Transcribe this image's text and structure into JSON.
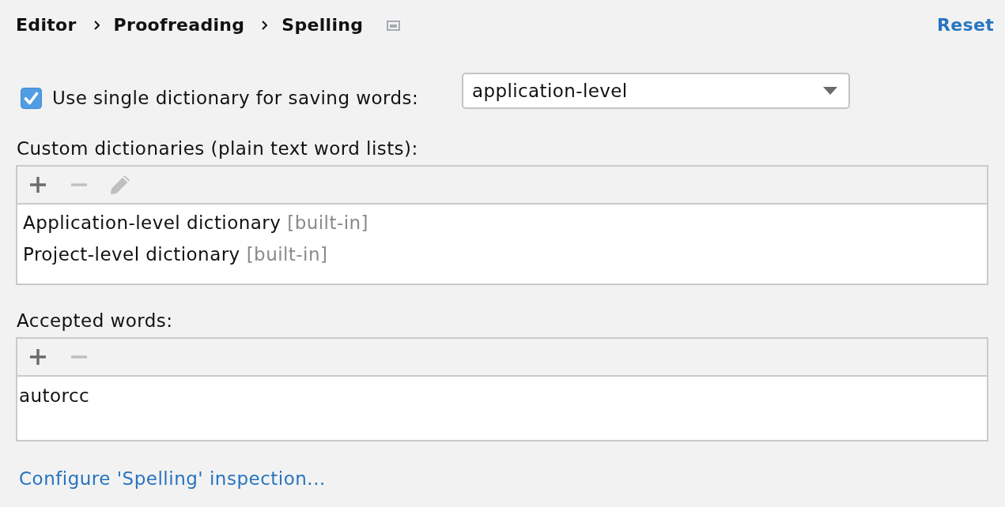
{
  "breadcrumb": [
    {
      "label": "Editor"
    },
    {
      "label": "Proofreading"
    },
    {
      "label": "Spelling"
    }
  ],
  "reset_link": "Reset",
  "use_single_dictionary": {
    "label": "Use single dictionary for saving words:",
    "checked": true
  },
  "dictionary_level": {
    "value": "application-level"
  },
  "custom_dictionaries": {
    "label": "Custom dictionaries (plain text word lists):",
    "toolbar": [
      {
        "kind": "add",
        "disabled": false
      },
      {
        "kind": "remove",
        "disabled": true
      },
      {
        "kind": "edit",
        "disabled": true
      }
    ],
    "items": [
      {
        "name": "Application-level dictionary",
        "note": "[built-in]",
        "selected": false
      },
      {
        "name": "Project-level dictionary",
        "note": "[built-in]",
        "selected": false
      }
    ]
  },
  "accepted_words": {
    "label": "Accepted words:",
    "toolbar": [
      {
        "kind": "add",
        "disabled": false
      },
      {
        "kind": "remove",
        "disabled": true
      }
    ],
    "items": [
      {
        "name": "autorcc",
        "selected": false
      }
    ]
  },
  "configure_link": "Configure 'Spelling' inspection..."
}
